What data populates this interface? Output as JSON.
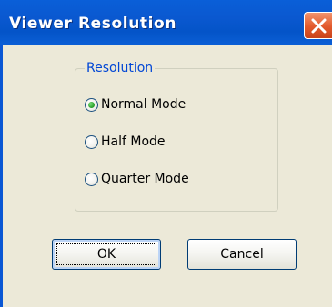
{
  "window": {
    "title": "Viewer Resolution",
    "close_icon": "close-icon"
  },
  "group": {
    "legend": "Resolution",
    "options": [
      {
        "label": "Normal Mode",
        "selected": true
      },
      {
        "label": "Half Mode",
        "selected": false
      },
      {
        "label": "Quarter Mode",
        "selected": false
      }
    ]
  },
  "buttons": {
    "ok_label": "OK",
    "cancel_label": "Cancel"
  },
  "colors": {
    "titlebar": "#0a58d0",
    "dialog_face": "#ece9d8",
    "legend_text": "#0046d5",
    "close_button": "#e2592c",
    "radio_dot": "#2fa52f"
  }
}
